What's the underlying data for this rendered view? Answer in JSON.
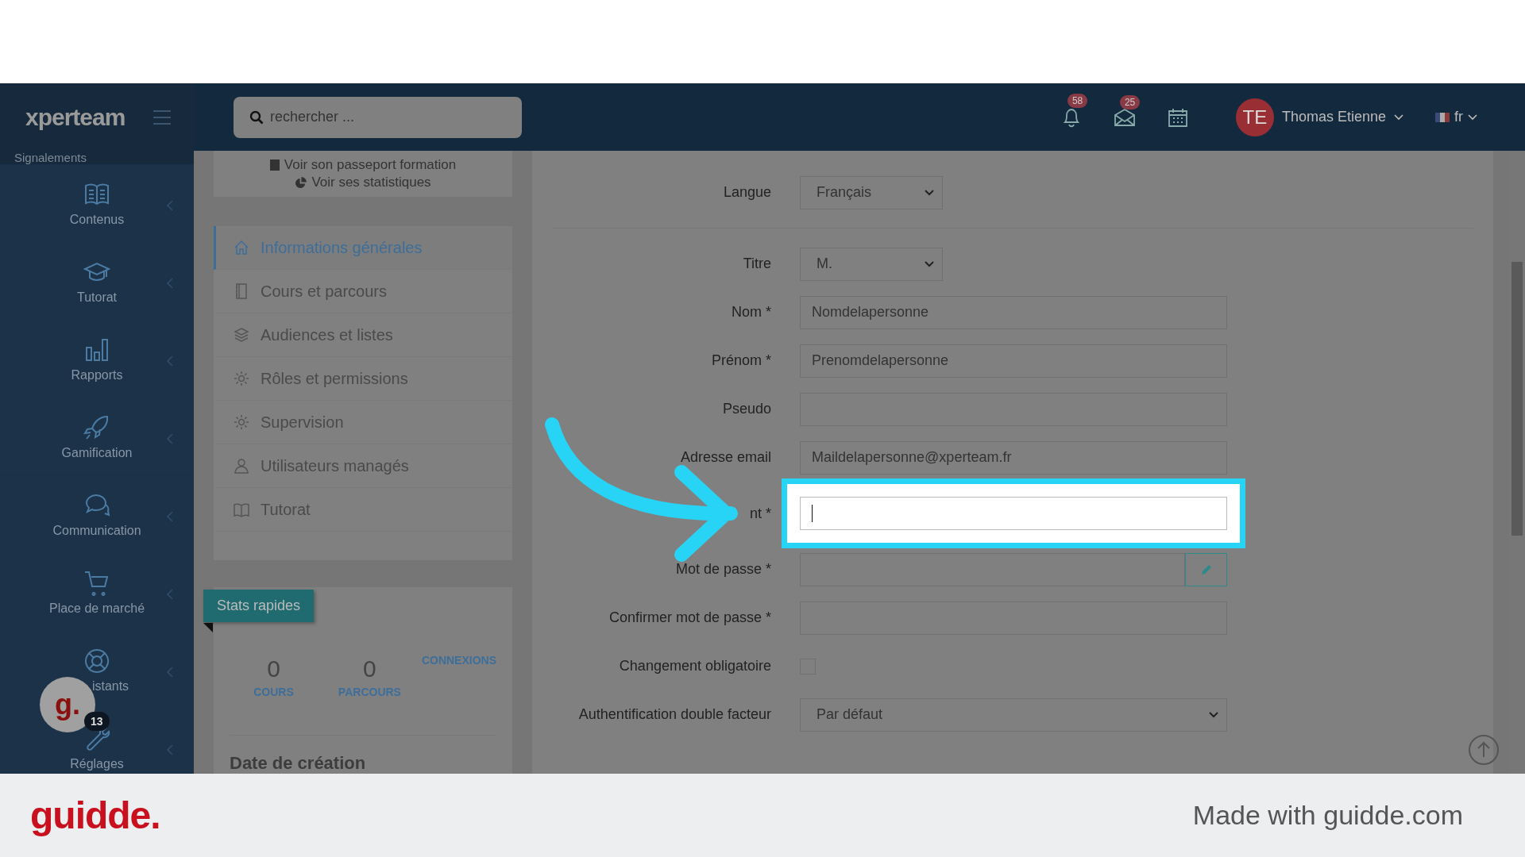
{
  "logo": "xperteam",
  "search": {
    "placeholder": "rechercher ..."
  },
  "topbar": {
    "notifications": "58",
    "messages": "25",
    "user": {
      "initials": "TE",
      "name": "Thomas Etienne"
    },
    "language": "fr"
  },
  "sidebar": {
    "items": [
      {
        "label": "Signalements",
        "kind": "header"
      },
      {
        "label": "Contenus",
        "kind": "contents"
      },
      {
        "label": "Tutorat",
        "kind": "tutoring"
      },
      {
        "label": "Rapports",
        "kind": "reports"
      },
      {
        "label": "Gamification",
        "kind": "gamification"
      },
      {
        "label": "Communication",
        "kind": "communication"
      },
      {
        "label": "Place de marché",
        "kind": "marketplace"
      },
      {
        "label": "istants",
        "kind": "assistants"
      },
      {
        "label": "Réglages",
        "kind": "settings"
      }
    ]
  },
  "profile_card": {
    "links": [
      {
        "label": "Voir son passeport formation",
        "kind": "passport"
      },
      {
        "label": "Voir ses statistiques",
        "kind": "stats"
      }
    ]
  },
  "menu": {
    "items": [
      {
        "label": "Informations générales",
        "kind": "home",
        "selected": true
      },
      {
        "label": "Cours et parcours",
        "kind": "notebook",
        "selected": false
      },
      {
        "label": "Audiences et listes",
        "kind": "layers",
        "selected": false
      },
      {
        "label": "Rôles et permissions",
        "kind": "gear",
        "selected": false
      },
      {
        "label": "Supervision",
        "kind": "gear",
        "selected": false
      },
      {
        "label": "Utilisateurs managés",
        "kind": "users",
        "selected": false
      },
      {
        "label": "Tutorat",
        "kind": "book",
        "selected": false
      }
    ]
  },
  "stats_card": {
    "tag": "Stats rapides",
    "stats": [
      {
        "value": "0",
        "label": "COURS"
      },
      {
        "value": "0",
        "label": "PARCOURS"
      }
    ],
    "connexions": "CONNEXIONS",
    "section_title": "Date de création"
  },
  "form": {
    "sections": [
      {
        "rows": [
          {
            "label": "Langue",
            "kind": "select",
            "value": "Français"
          }
        ]
      },
      {
        "rows": [
          {
            "label": "Titre",
            "kind": "select",
            "value": "M."
          },
          {
            "label": "Nom *",
            "kind": "text",
            "value": "Nomdelapersonne"
          },
          {
            "label": "Prénom *",
            "kind": "text",
            "value": "Prenomdelapersonne"
          },
          {
            "label": "Pseudo",
            "kind": "text"
          },
          {
            "label": "Adresse email",
            "kind": "text",
            "value": "Maildelapersonne@xperteam.fr"
          },
          {
            "label": "nt *",
            "kind": "focused"
          },
          {
            "label": "Mot de passe *",
            "kind": "password"
          },
          {
            "label": "Confirmer mot de passe *",
            "kind": "text"
          },
          {
            "label": "Changement obligatoire",
            "kind": "checkbox",
            "checked": false
          },
          {
            "label": "Authentification double facteur",
            "kind": "wideselect",
            "value": "Par défaut"
          }
        ]
      }
    ]
  },
  "guidde_bubble": {
    "letter": "g.",
    "count": "13"
  },
  "footer": {
    "brand": "guidde.",
    "credit": "Made with guidde.com"
  }
}
